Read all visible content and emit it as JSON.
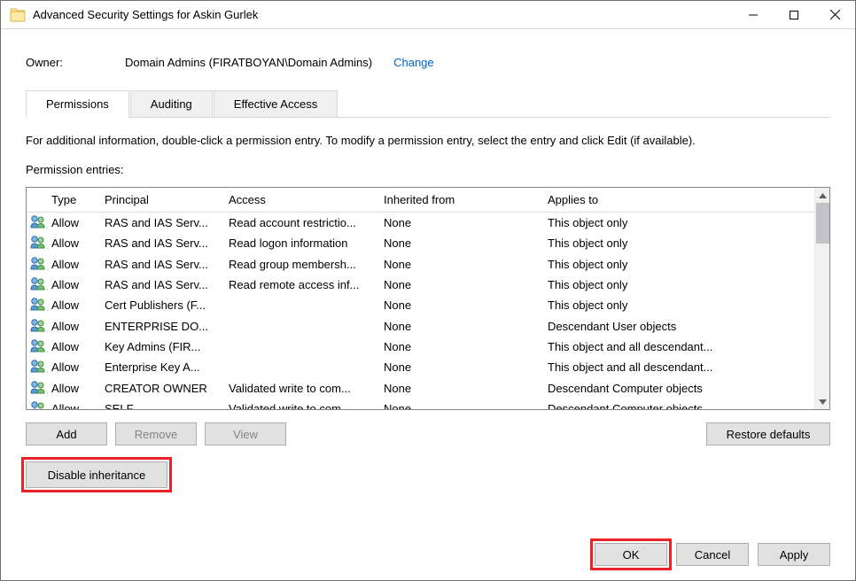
{
  "window": {
    "title": "Advanced Security Settings for Askin Gurlek"
  },
  "owner": {
    "label": "Owner:",
    "value": "Domain Admins (FIRATBOYAN\\Domain Admins)",
    "change_label": "Change"
  },
  "tabs": {
    "permissions": "Permissions",
    "auditing": "Auditing",
    "effective": "Effective Access"
  },
  "instructions": "For additional information, double-click a permission entry. To modify a permission entry, select the entry and click Edit (if available).",
  "entries_label": "Permission entries:",
  "columns": {
    "type": "Type",
    "principal": "Principal",
    "access": "Access",
    "inherited": "Inherited from",
    "applies": "Applies to"
  },
  "rows": [
    {
      "type": "Allow",
      "principal": "RAS and IAS Serv...",
      "access": "Read account restrictio...",
      "inherited": "None",
      "applies": "This object only"
    },
    {
      "type": "Allow",
      "principal": "RAS and IAS Serv...",
      "access": "Read logon information",
      "inherited": "None",
      "applies": "This object only"
    },
    {
      "type": "Allow",
      "principal": "RAS and IAS Serv...",
      "access": "Read group membersh...",
      "inherited": "None",
      "applies": "This object only"
    },
    {
      "type": "Allow",
      "principal": "RAS and IAS Serv...",
      "access": "Read remote access inf...",
      "inherited": "None",
      "applies": "This object only"
    },
    {
      "type": "Allow",
      "principal": "Cert Publishers (F...",
      "access": "",
      "inherited": "None",
      "applies": "This object only"
    },
    {
      "type": "Allow",
      "principal": "ENTERPRISE DO...",
      "access": "",
      "inherited": "None",
      "applies": "Descendant User objects"
    },
    {
      "type": "Allow",
      "principal": "Key Admins (FIR...",
      "access": "",
      "inherited": "None",
      "applies": "This object and all descendant..."
    },
    {
      "type": "Allow",
      "principal": "Enterprise Key A...",
      "access": "",
      "inherited": "None",
      "applies": "This object and all descendant..."
    },
    {
      "type": "Allow",
      "principal": "CREATOR OWNER",
      "access": "Validated write to com...",
      "inherited": "None",
      "applies": "Descendant Computer objects"
    },
    {
      "type": "Allow",
      "principal": "SELF",
      "access": "Validated write to com...",
      "inherited": "None",
      "applies": "Descendant Computer objects"
    }
  ],
  "buttons": {
    "add": "Add",
    "remove": "Remove",
    "view": "View",
    "restore": "Restore defaults",
    "disable": "Disable inheritance",
    "ok": "OK",
    "cancel": "Cancel",
    "apply": "Apply"
  }
}
